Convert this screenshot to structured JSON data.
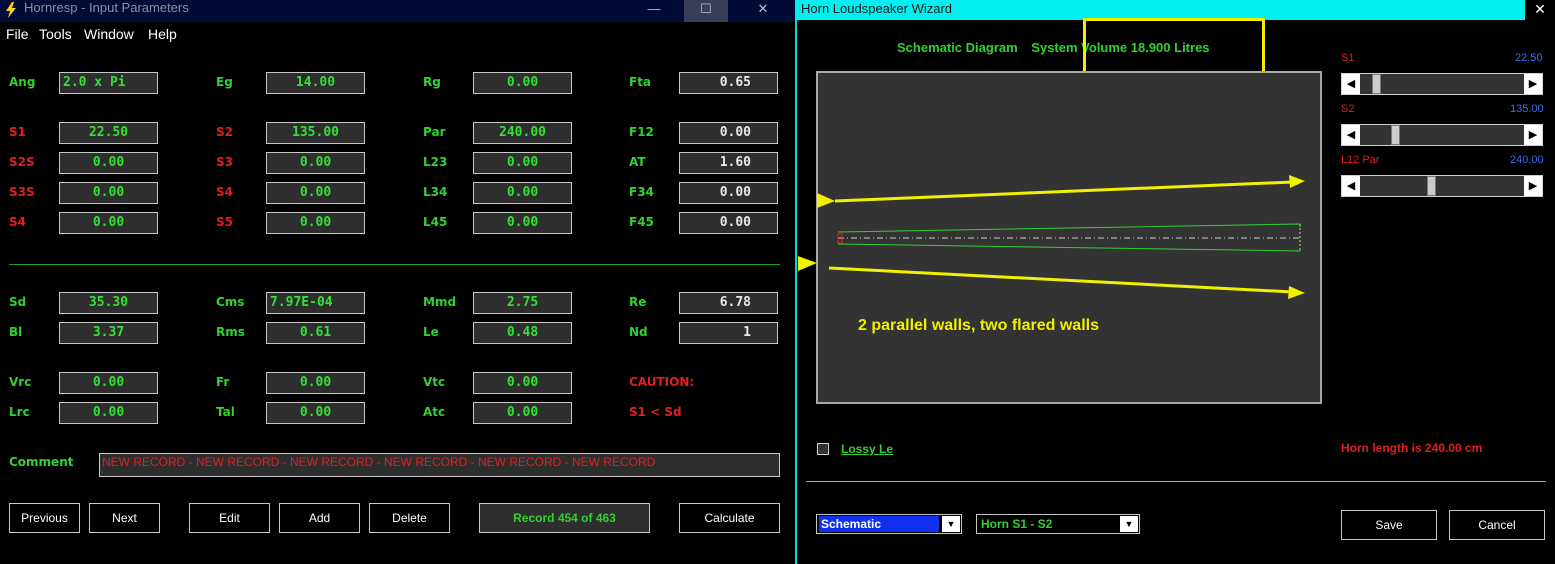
{
  "left_window": {
    "title": "Hornresp - Input Parameters",
    "min_icon": "minimize-icon",
    "max_icon": "maximize-icon",
    "close_icon": "close-icon",
    "min_glyph": "—",
    "max_glyph": "☐",
    "close_glyph": "✕"
  },
  "menu": [
    "File",
    "Tools",
    "Window",
    "Help"
  ],
  "params": {
    "Ang": {
      "label": "Ang",
      "value": "2.0 x Pi"
    },
    "Eg": {
      "label": "Eg",
      "value": "14.00"
    },
    "Rg": {
      "label": "Rg",
      "value": "0.00"
    },
    "Fta": {
      "label": "Fta",
      "value": "0.65"
    },
    "S1": {
      "label": "S1",
      "value": "22.50"
    },
    "S2": {
      "label": "S2",
      "value": "135.00"
    },
    "Par": {
      "label": "Par",
      "value": "240.00"
    },
    "F12": {
      "label": "F12",
      "value": "0.00"
    },
    "S2S": {
      "label": "S2S",
      "value": "0.00"
    },
    "S3": {
      "label": "S3",
      "value": "0.00"
    },
    "L23": {
      "label": "L23",
      "value": "0.00"
    },
    "AT": {
      "label": "AT",
      "value": "1.60"
    },
    "S3S": {
      "label": "S3S",
      "value": "0.00"
    },
    "S4": {
      "label": "S4",
      "value": "0.00"
    },
    "L34": {
      "label": "L34",
      "value": "0.00"
    },
    "F34": {
      "label": "F34",
      "value": "0.00"
    },
    "S4b": {
      "label": "S4",
      "value": "0.00"
    },
    "S5": {
      "label": "S5",
      "value": "0.00"
    },
    "L45": {
      "label": "L45",
      "value": "0.00"
    },
    "F45": {
      "label": "F45",
      "value": "0.00"
    },
    "Sd": {
      "label": "Sd",
      "value": "35.30"
    },
    "Cms": {
      "label": "Cms",
      "value": "7.97E-04"
    },
    "Mmd": {
      "label": "Mmd",
      "value": "2.75"
    },
    "Re": {
      "label": "Re",
      "value": "6.78"
    },
    "Bl": {
      "label": "Bl",
      "value": "3.37"
    },
    "Rms": {
      "label": "Rms",
      "value": "0.61"
    },
    "Le": {
      "label": "Le",
      "value": "0.48"
    },
    "Nd": {
      "label": "Nd",
      "value": "1"
    },
    "Vrc": {
      "label": "Vrc",
      "value": "0.00"
    },
    "Fr": {
      "label": "Fr",
      "value": "0.00"
    },
    "Vtc": {
      "label": "Vtc",
      "value": "0.00"
    },
    "Lrc": {
      "label": "Lrc",
      "value": "0.00"
    },
    "Tal": {
      "label": "Tal",
      "value": "0.00"
    },
    "Atc": {
      "label": "Atc",
      "value": "0.00"
    }
  },
  "caution": {
    "line1": "CAUTION:",
    "line2": "S1 < Sd"
  },
  "comment": {
    "label": "Comment",
    "value": "NEW RECORD - NEW RECORD - NEW RECORD - NEW RECORD - NEW RECORD - NEW RECORD"
  },
  "buttons": {
    "previous": "Previous",
    "next": "Next",
    "edit": "Edit",
    "add": "Add",
    "delete": "Delete",
    "record": "Record 454 of 463",
    "calculate": "Calculate"
  },
  "wizard": {
    "title": "Horn Loudspeaker Wizard",
    "close_glyph": "✕",
    "diagram_label": "Schematic Diagram",
    "volume_label": "System Volume 18.900 Litres",
    "annotation": "2 parallel walls, two flared walls",
    "sliders": [
      {
        "label": "S1",
        "value": "22.50",
        "level": 0.08
      },
      {
        "label": "S2",
        "value": "135.00",
        "level": 0.2
      },
      {
        "label": "L12  Par",
        "value": "240.00",
        "level": 0.43
      }
    ],
    "lossy_le": "Lossy Le",
    "horn_length": "Horn length is 240.00 cm",
    "combo_view": "Schematic",
    "combo_horn": "Horn S1 - S2",
    "save": "Save",
    "cancel": "Cancel"
  },
  "colors": {
    "accent_green": "#2fd22f",
    "label_red": "#e01f1f",
    "highlight_yellow": "#f0f000",
    "title_cyan": "#00f0f0"
  }
}
